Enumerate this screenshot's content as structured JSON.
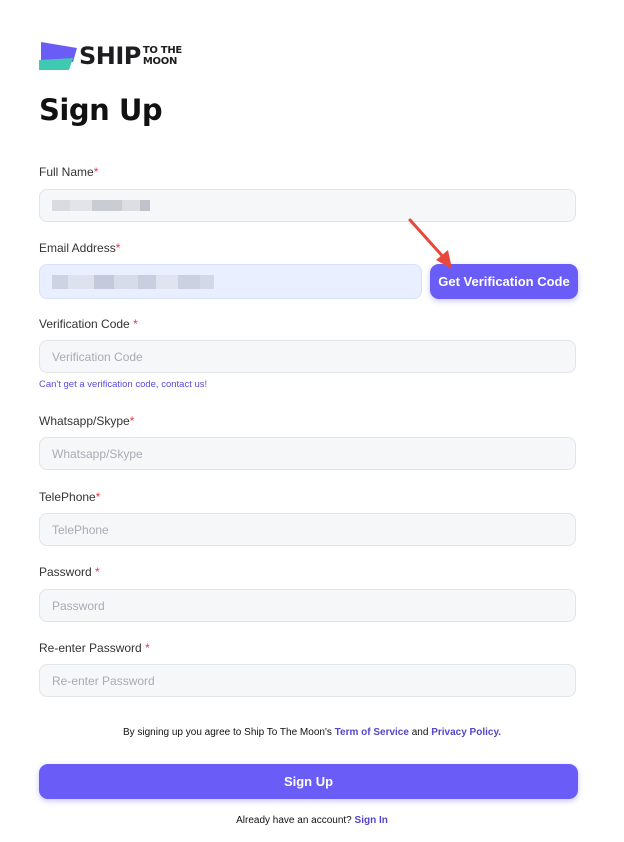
{
  "brand": {
    "logo_main": "SHIP",
    "logo_sub_top": "TO THE",
    "logo_sub_bottom": "MOON",
    "colors": {
      "logo_purple": "#6a5cf6",
      "logo_teal": "#3ec9b0"
    }
  },
  "page_title": "Sign Up",
  "form": {
    "full_name": {
      "label": "Full Name",
      "required_mark": "*",
      "value_redacted": true
    },
    "email": {
      "label": "Email Address",
      "required_mark": "*",
      "value_redacted": true
    },
    "verify_button": "Get Verification Code",
    "verification_code": {
      "label": "Verification Code",
      "required_mark": "*",
      "placeholder": "Verification Code"
    },
    "help_link": "Can't get a verification code, contact us!",
    "whatsapp": {
      "label": "Whatsapp/Skype",
      "required_mark": "*",
      "placeholder": "Whatsapp/Skype"
    },
    "telephone": {
      "label": "TelePhone",
      "required_mark": "*",
      "placeholder": "TelePhone"
    },
    "password": {
      "label": "Password",
      "required_mark": "*",
      "placeholder": "Password"
    },
    "reenter_password": {
      "label": "Re-enter Password",
      "required_mark": "*",
      "placeholder": "Re-enter Password"
    }
  },
  "terms": {
    "prefix": "By signing up you agree to Ship To The Moon's ",
    "tos": "Term of Service",
    "and": " and ",
    "privacy": "Privacy Policy."
  },
  "signup_button": "Sign Up",
  "signin": {
    "prefix": "Already have an account? ",
    "link": "Sign In"
  },
  "colors": {
    "accent": "#6a5cf6",
    "required": "#e8344e",
    "annotation_arrow": "#e8473c"
  }
}
